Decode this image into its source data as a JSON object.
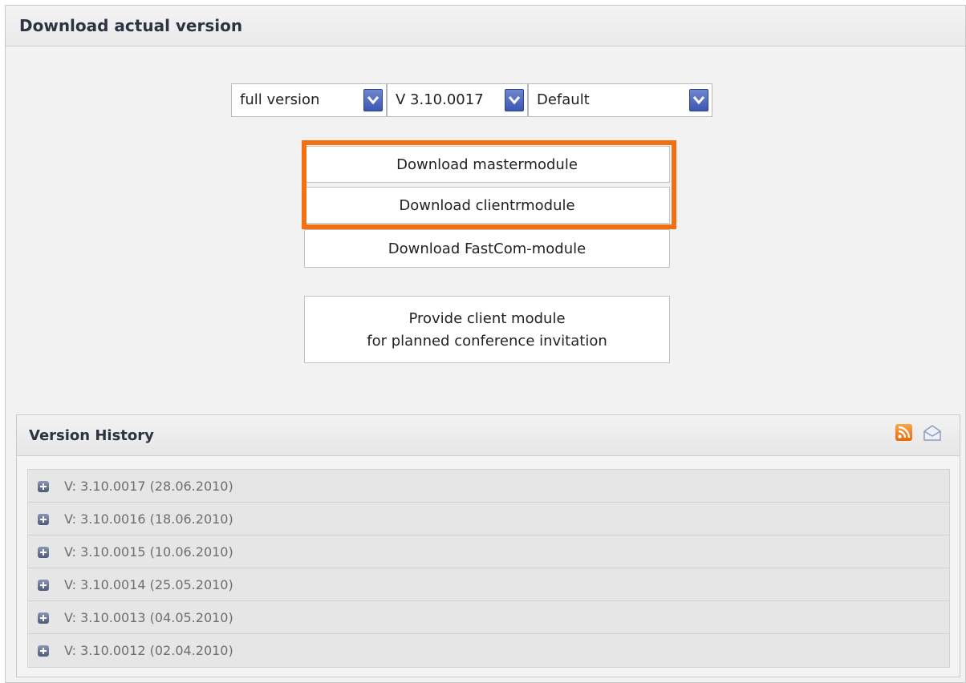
{
  "panel": {
    "title": "Download actual version"
  },
  "selects": {
    "edition": "full version",
    "version": "V 3.10.0017",
    "profile": "Default"
  },
  "buttons": {
    "master": "Download mastermodule",
    "client": "Download clientrmodule",
    "fastcom": "Download FastCom-module",
    "provide_line1": "Provide client module",
    "provide_line2": "for planned conference invitation"
  },
  "colors": {
    "highlight": "#f26f12",
    "select_arrow": "#3b56b2"
  },
  "history": {
    "title": "Version History",
    "icons": [
      "rss-feed-icon",
      "mail-subscribe-icon"
    ],
    "items": [
      "V: 3.10.0017 (28.06.2010)",
      "V: 3.10.0016 (18.06.2010)",
      "V: 3.10.0015 (10.06.2010)",
      "V: 3.10.0014 (25.05.2010)",
      "V: 3.10.0013 (04.05.2010)",
      "V: 3.10.0012 (02.04.2010)"
    ]
  }
}
